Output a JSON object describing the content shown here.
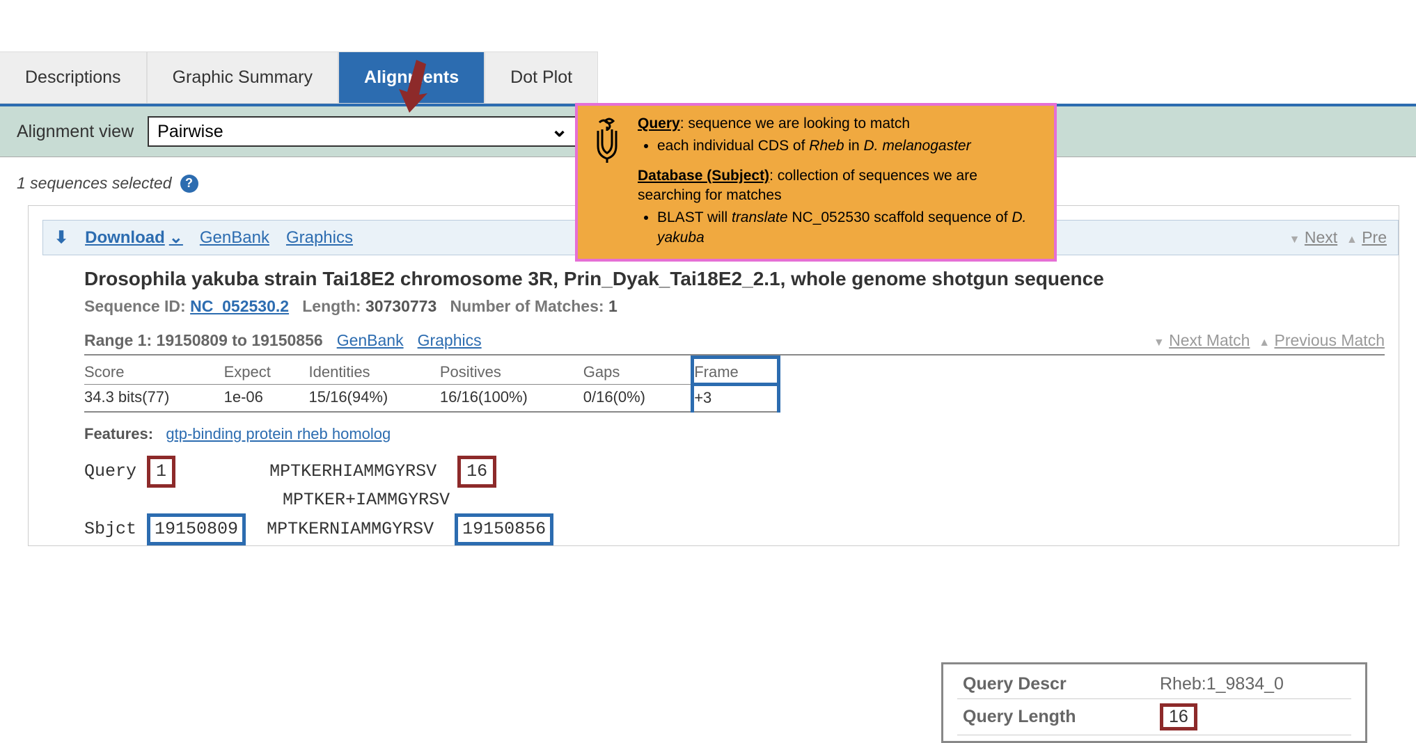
{
  "tabs": {
    "descriptions": "Descriptions",
    "graphic_summary": "Graphic Summary",
    "alignments": "Alignments",
    "dot_plot": "Dot Plot"
  },
  "alignment_view": {
    "label": "Alignment view",
    "selected": "Pairwise"
  },
  "seq_selected": "1 sequences selected",
  "panel_header": {
    "download": "Download",
    "genbank": "GenBank",
    "graphics": "Graphics",
    "next": "Next",
    "previous": "Pre"
  },
  "sequence": {
    "title": "Drosophila yakuba strain Tai18E2 chromosome 3R, Prin_Dyak_Tai18E2_2.1, whole genome shotgun sequence",
    "id_label": "Sequence ID:",
    "id": "NC_052530.2",
    "length_label": "Length:",
    "length": "30730773",
    "matches_label": "Number of Matches:",
    "matches": "1"
  },
  "range": {
    "label": "Range 1: 19150809 to 19150856",
    "genbank": "GenBank",
    "graphics": "Graphics",
    "next_match": "Next Match",
    "prev_match": "Previous Match"
  },
  "stats": {
    "headers": {
      "score": "Score",
      "expect": "Expect",
      "identities": "Identities",
      "positives": "Positives",
      "gaps": "Gaps",
      "frame": "Frame"
    },
    "values": {
      "score": "34.3 bits(77)",
      "expect": "1e-06",
      "identities": "15/16(94%)",
      "positives": "16/16(100%)",
      "gaps": "0/16(0%)",
      "frame": "+3"
    }
  },
  "features": {
    "label": "Features:",
    "link": "gtp-binding protein rheb homolog"
  },
  "alignment": {
    "query_label": "Query",
    "query_start": "1",
    "query_seq": "MPTKERHIAMMGYRSV",
    "query_end": "16",
    "mid_seq": "MPTKER+IAMMGYRSV",
    "sbjct_label": "Sbjct",
    "sbjct_start": "19150809",
    "sbjct_seq": "MPTKERNIAMMGYRSV",
    "sbjct_end": "19150856"
  },
  "query_info": {
    "descr_label": "Query Descr",
    "descr_value": "Rheb:1_9834_0",
    "length_label": "Query Length",
    "length_value": "16"
  },
  "callout": {
    "query_label": "Query",
    "query_text": ": sequence we are looking to match",
    "query_bullet_prefix": "each individual CDS of ",
    "query_bullet_gene": "Rheb",
    "query_bullet_mid": " in ",
    "query_bullet_species": "D. melanogaster",
    "db_label": "Database (Subject)",
    "db_text": ": collection of sequences we are searching for matches",
    "db_bullet_prefix": "BLAST will ",
    "db_bullet_em": "translate",
    "db_bullet_mid": " NC_052530 scaffold sequence of ",
    "db_bullet_species": "D. yakuba"
  }
}
